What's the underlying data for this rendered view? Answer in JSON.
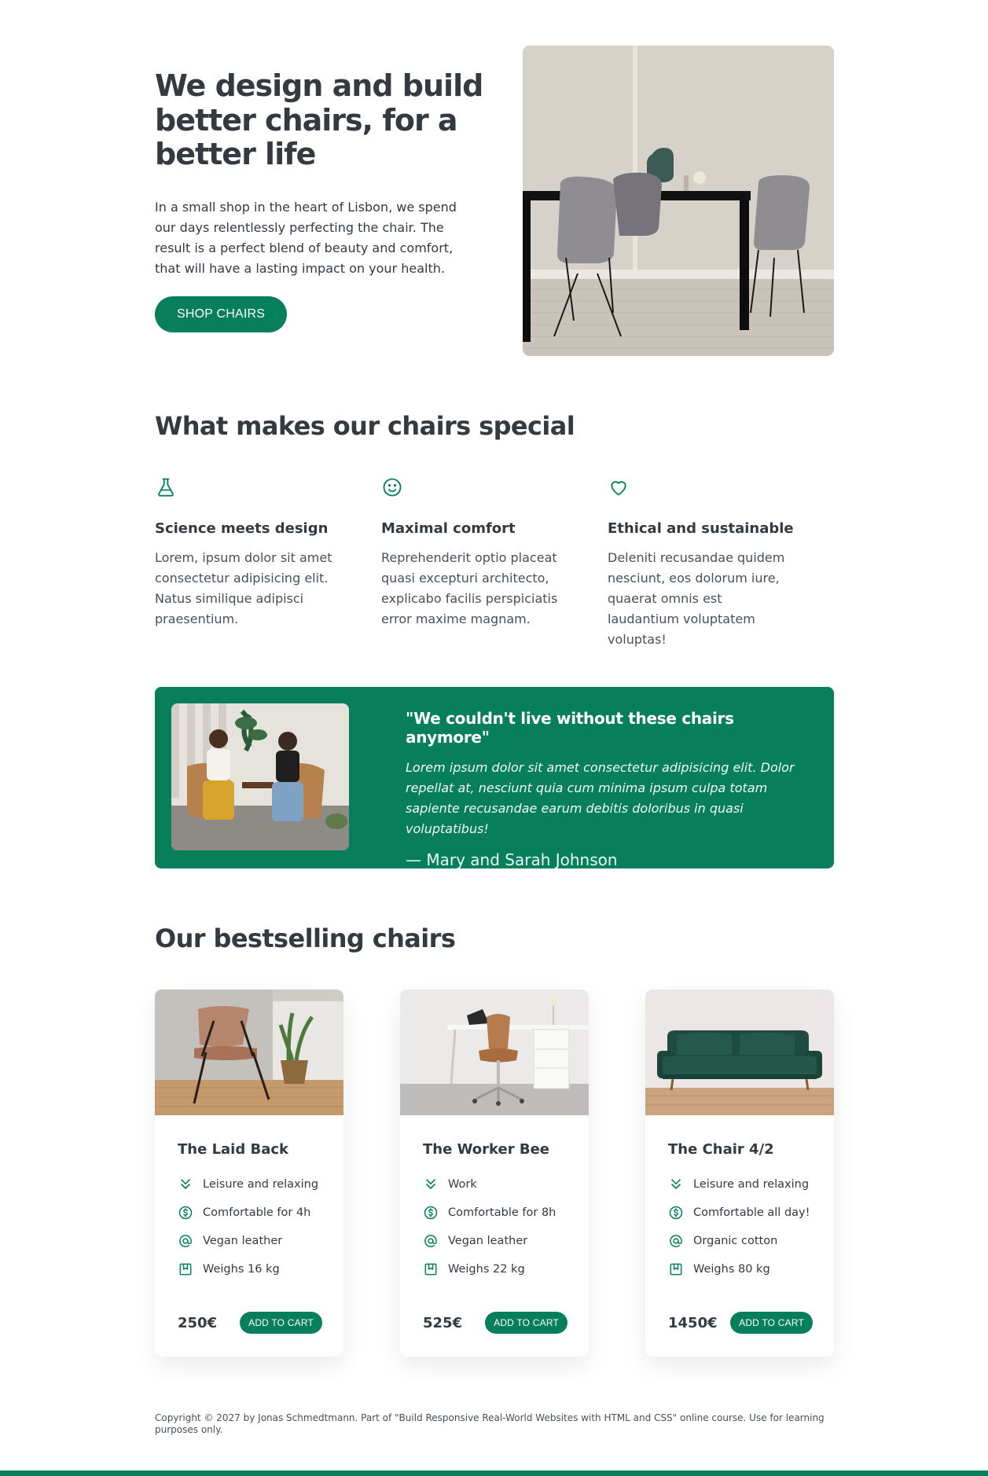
{
  "hero": {
    "title": "We design and build better chairs, for a better life",
    "description": "In a small shop in the heart of Lisbon, we spend our days relentlessly perfecting the chair. The result is a perfect blend of beauty and comfort, that will have a lasting impact on your health.",
    "cta_label": "SHOP CHAIRS"
  },
  "special": {
    "title": "What makes our chairs special",
    "features": [
      {
        "icon": "flask-icon",
        "title": "Science meets design",
        "text": "Lorem, ipsum dolor sit amet consectetur adipisicing elit. Natus similique adipisci praesentium."
      },
      {
        "icon": "smile-icon",
        "title": "Maximal comfort",
        "text": "Reprehenderit optio placeat quasi excepturi architecto, explicabo facilis perspiciatis error maxime magnam."
      },
      {
        "icon": "heart-icon",
        "title": "Ethical and sustainable",
        "text": "Deleniti recusandae quidem nesciunt, eos dolorum iure, quaerat omnis est laudantium voluptatem voluptas!"
      }
    ]
  },
  "testimonial": {
    "quote": "\"We couldn't live without these chairs anymore\"",
    "text": "Lorem ipsum dolor sit amet consectetur adipisicing elit. Dolor repellat at, nesciunt quia cum minima ipsum culpa totam sapiente recusandae earum debitis doloribus in quasi voluptatibus!",
    "author": "— Mary and Sarah Johnson"
  },
  "bestsellers": {
    "title": "Our bestselling chairs",
    "cart_label": "ADD TO CART",
    "products": [
      {
        "name": "The Laid Back",
        "attrs": [
          "Leisure and relaxing",
          "Comfortable for 4h",
          "Vegan leather",
          "Weighs 16 kg"
        ],
        "price": "250€"
      },
      {
        "name": "The Worker Bee",
        "attrs": [
          "Work",
          "Comfortable for 8h",
          "Vegan leather",
          "Weighs 22 kg"
        ],
        "price": "525€"
      },
      {
        "name": "The Chair 4/2",
        "attrs": [
          "Leisure and relaxing",
          "Comfortable all day!",
          "Organic cotton",
          "Weighs 80 kg"
        ],
        "price": "1450€"
      }
    ],
    "attr_icons": [
      "chevrons-down-icon",
      "dollar-circle-icon",
      "at-sign-icon",
      "bookmark-icon"
    ]
  },
  "footer": {
    "copyright": "Copyright © 2027 by Jonas Schmedtmann. Part of \"Build Responsive Real-World Websites with HTML and CSS\" online course. Use for learning purposes only."
  },
  "colors": {
    "primary": "#087f5b",
    "text": "#343a40"
  }
}
